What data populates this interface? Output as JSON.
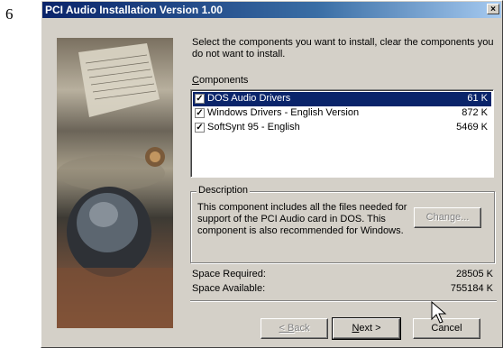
{
  "page_number": "6",
  "dialog": {
    "title": "PCI Audio Installation Version 1.00",
    "close_glyph": "×",
    "instruction": "Select the components you want to install, clear the components you do not want to install.",
    "components_label_u": "C",
    "components_label_rest": "omponents",
    "components": [
      {
        "label": "DOS Audio Drivers",
        "size": "61 K",
        "checked": true,
        "selected": true
      },
      {
        "label": "Windows Drivers - English Version",
        "size": "872 K",
        "checked": true,
        "selected": false
      },
      {
        "label": "SoftSynt 95 - English",
        "size": "5469 K",
        "checked": true,
        "selected": false
      }
    ],
    "description_title": "Description",
    "description_text": "This component includes all the files needed for support of the PCI Audio card in DOS. This component is also recommended for Windows.",
    "change_button": "Change...",
    "space_required_label": "Space Required:",
    "space_required_value": "28505 K",
    "space_available_label": "Space Available:",
    "space_available_value": "755184 K",
    "back_button_u": "< B",
    "back_button_rest": "ack",
    "next_button_u": "N",
    "next_button_rest": "ext >",
    "cancel_button": "Cancel"
  }
}
